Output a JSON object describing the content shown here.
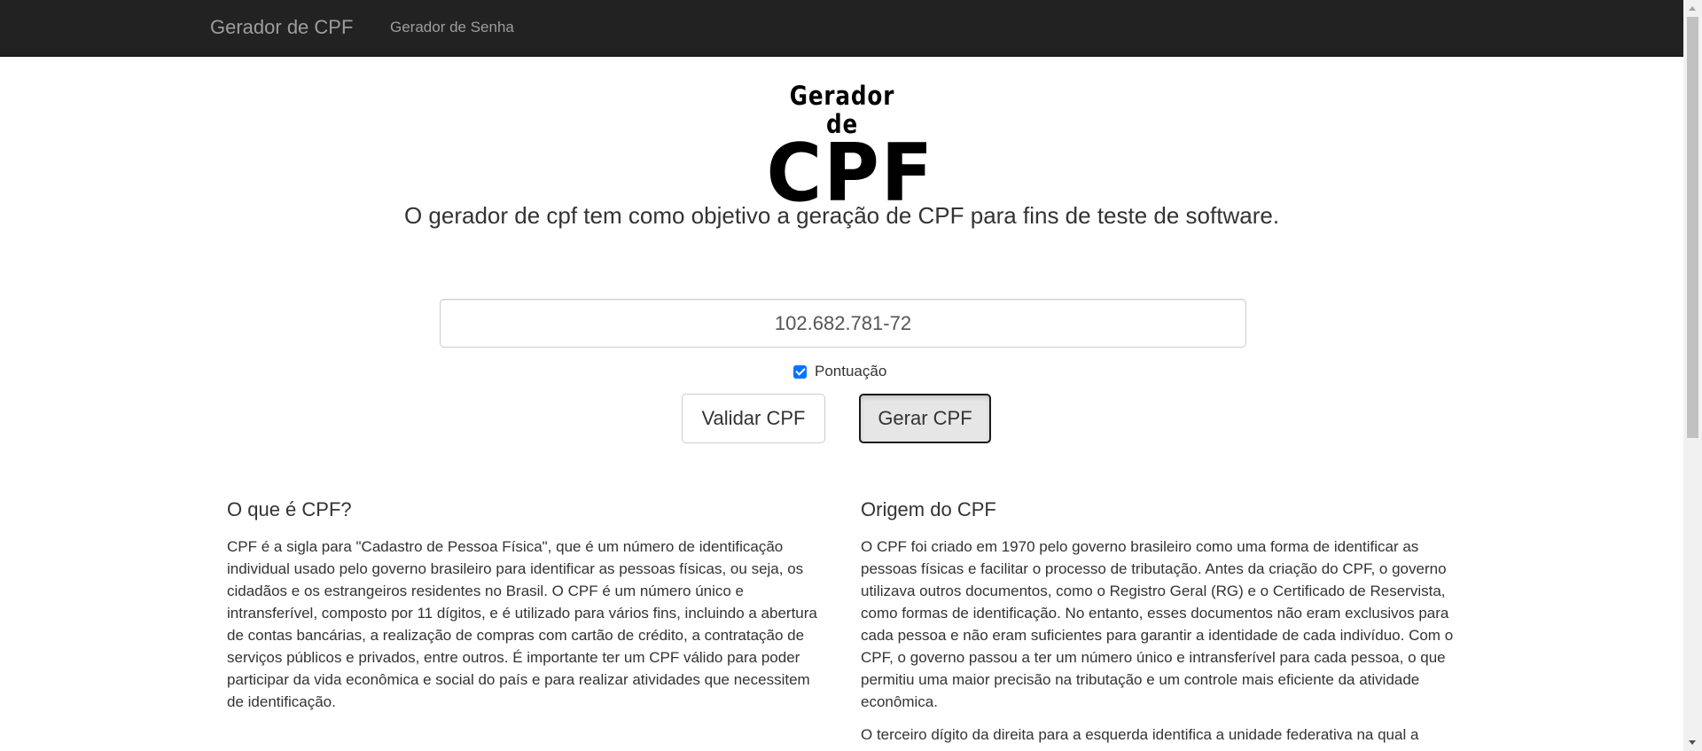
{
  "navbar": {
    "brand": "Gerador de CPF",
    "links": [
      "Gerador de Senha"
    ]
  },
  "logo": {
    "line1": "Gerador de",
    "line2": "CPF"
  },
  "subtitle": "O gerador de cpf tem como objetivo a geração de CPF para fins de teste de software.",
  "cpf_field": {
    "value": "102.682.781-72"
  },
  "punctuation_checkbox": {
    "label": "Pontuação",
    "checked": true
  },
  "buttons": {
    "validate": "Validar CPF",
    "generate": "Gerar CPF"
  },
  "sections": {
    "what_is": {
      "title": "O que é CPF?",
      "paragraphs": [
        "CPF é a sigla para \"Cadastro de Pessoa Física\", que é um número de identificação individual usado pelo governo brasileiro para identificar as pessoas físicas, ou seja, os cidadãos e os estrangeiros residentes no Brasil. O CPF é um número único e intransferível, composto por 11 dígitos, e é utilizado para vários fins, incluindo a abertura de contas bancárias, a realização de compras com cartão de crédito, a contratação de serviços públicos e privados, entre outros. É importante ter um CPF válido para poder participar da vida econômica e social do país e para realizar atividades que necessitem de identificação."
      ]
    },
    "origin": {
      "title": "Origem do CPF",
      "paragraphs": [
        "O CPF foi criado em 1970 pelo governo brasileiro como uma forma de identificar as pessoas físicas e facilitar o processo de tributação. Antes da criação do CPF, o governo utilizava outros documentos, como o Registro Geral (RG) e o Certificado de Reservista, como formas de identificação. No entanto, esses documentos não eram exclusivos para cada pessoa e não eram suficientes para garantir a identidade de cada indivíduo. Com o CPF, o governo passou a ter um número único e intransferível para cada pessoa, o que permitiu uma maior precisão na tributação e um controle mais eficiente da atividade econômica.",
        "O terceiro dígito da direita para a esquerda identifica a unidade federativa na qual a pessoa foi registrada, de acordo com o dígito final, conforme a tabela abaixo."
      ]
    }
  }
}
